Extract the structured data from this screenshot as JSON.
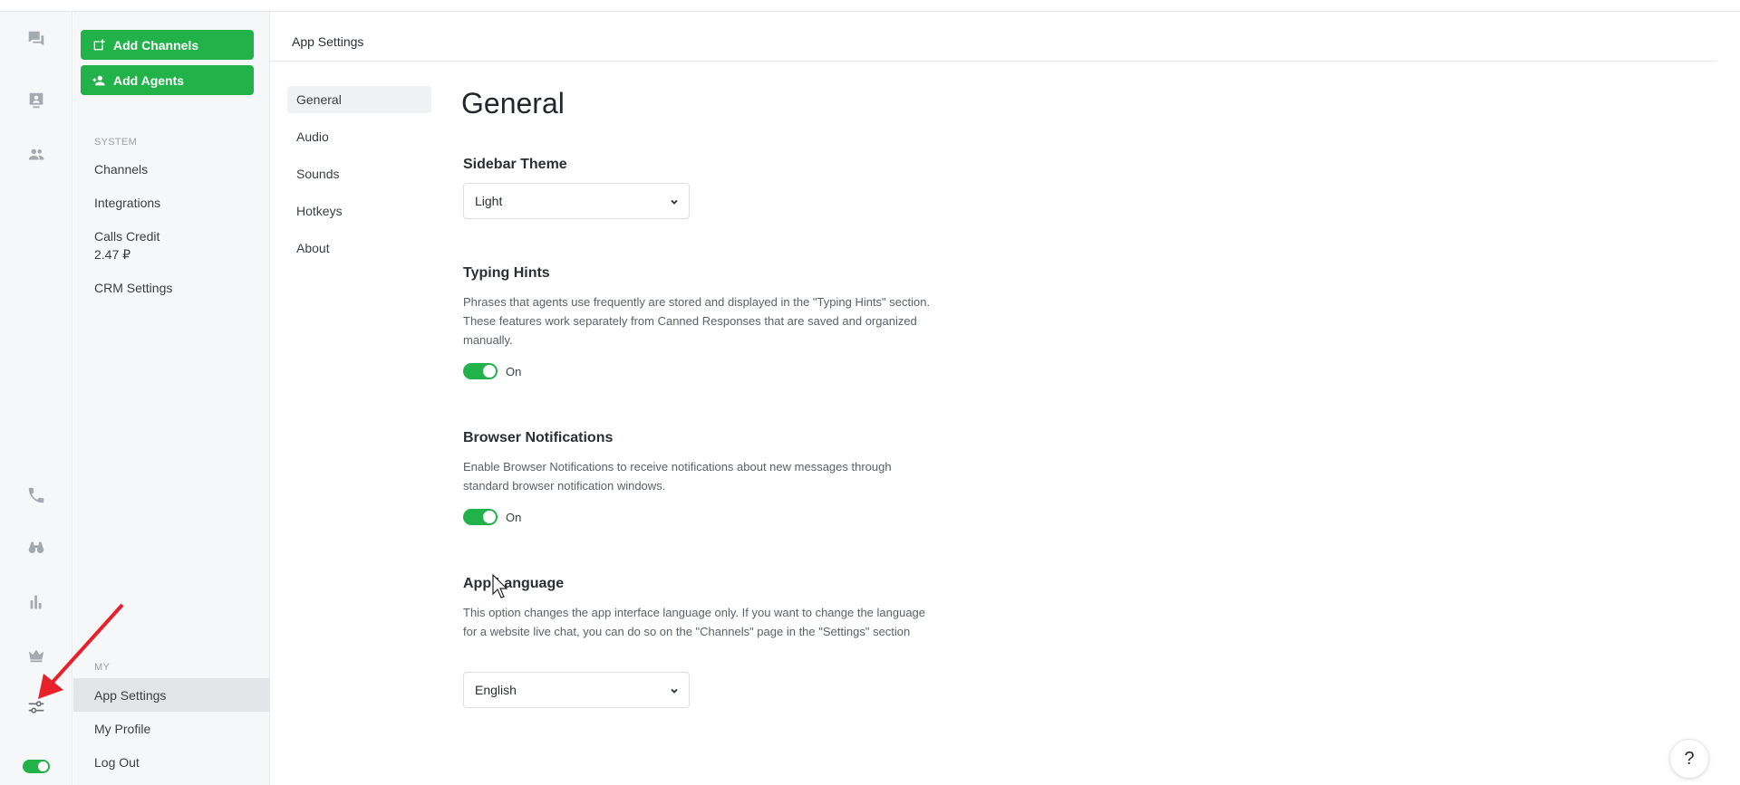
{
  "rail": {
    "icons": [
      "chat-icon",
      "contacts-card-icon",
      "agents-group-icon",
      "phone-icon",
      "binoculars-icon",
      "bar-chart-icon",
      "crown-icon",
      "sliders-icon"
    ],
    "accent": "#21b24a"
  },
  "nav": {
    "add_channels": "Add Channels",
    "add_agents": "Add Agents",
    "system_label": "SYSTEM",
    "channels": "Channels",
    "integrations": "Integrations",
    "calls_credit": "Calls Credit",
    "calls_credit_value": "2.47 ₽",
    "crm_settings": "CRM Settings",
    "my_label": "MY",
    "app_settings": "App Settings",
    "my_profile": "My Profile",
    "log_out": "Log Out"
  },
  "header": {
    "title": "App Settings"
  },
  "settings_menu": {
    "items": [
      {
        "label": "General",
        "active": true
      },
      {
        "label": "Audio",
        "active": false
      },
      {
        "label": "Sounds",
        "active": false
      },
      {
        "label": "Hotkeys",
        "active": false
      },
      {
        "label": "About",
        "active": false
      }
    ]
  },
  "main": {
    "title": "General",
    "sidebar_theme": {
      "title": "Sidebar Theme",
      "value": "Light"
    },
    "typing_hints": {
      "title": "Typing Hints",
      "description": "Phrases that agents use frequently are stored and displayed in the \"Typing Hints\" section. These features work separately from Canned Responses that are saved and organized manually.",
      "state": "On"
    },
    "browser_notifications": {
      "title": "Browser Notifications",
      "description": "Enable Browser Notifications to receive notifications about new messages through standard browser notification windows.",
      "state": "On"
    },
    "app_language": {
      "title": "App Language",
      "description": "This option changes the app interface language only. If you want to change the language for a website live chat, you can do so on the \"Channels\" page in the \"Settings\" section",
      "value": "English"
    }
  },
  "help": {
    "label": "?"
  },
  "colors": {
    "green": "#21b24a",
    "arrow": "#e8202a"
  }
}
